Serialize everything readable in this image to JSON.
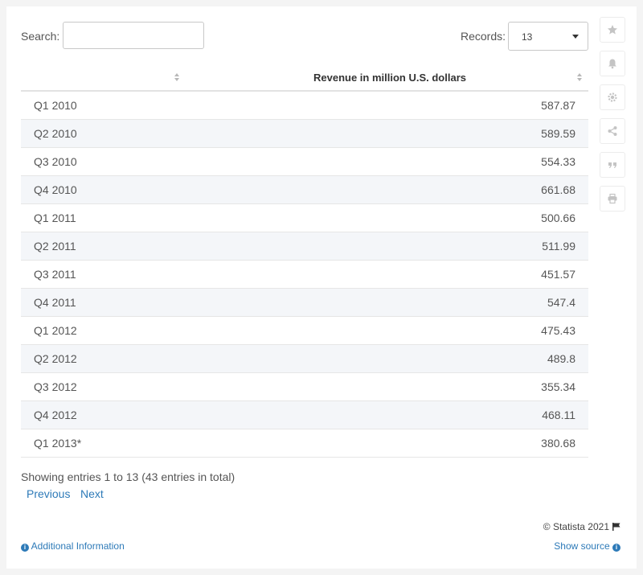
{
  "search": {
    "label": "Search:",
    "value": "",
    "placeholder": ""
  },
  "records": {
    "label": "Records:",
    "selected": "13"
  },
  "table": {
    "headers": [
      "",
      "Revenue in million U.S. dollars"
    ],
    "rows": [
      [
        "Q1 2010",
        "587.87"
      ],
      [
        "Q2 2010",
        "589.59"
      ],
      [
        "Q3 2010",
        "554.33"
      ],
      [
        "Q4 2010",
        "661.68"
      ],
      [
        "Q1 2011",
        "500.66"
      ],
      [
        "Q2 2011",
        "511.99"
      ],
      [
        "Q3 2011",
        "451.57"
      ],
      [
        "Q4 2011",
        "547.4"
      ],
      [
        "Q1 2012",
        "475.43"
      ],
      [
        "Q2 2012",
        "489.8"
      ],
      [
        "Q3 2012",
        "355.34"
      ],
      [
        "Q4 2012",
        "468.11"
      ],
      [
        "Q1 2013*",
        "380.68"
      ]
    ]
  },
  "chart_data": {
    "type": "table",
    "columns": [
      "",
      "Revenue in million U.S. dollars"
    ],
    "categories": [
      "Q1 2010",
      "Q2 2010",
      "Q3 2010",
      "Q4 2010",
      "Q1 2011",
      "Q2 2011",
      "Q3 2011",
      "Q4 2011",
      "Q1 2012",
      "Q2 2012",
      "Q3 2012",
      "Q4 2012",
      "Q1 2013*"
    ],
    "values": [
      587.87,
      589.59,
      554.33,
      661.68,
      500.66,
      511.99,
      451.57,
      547.4,
      475.43,
      489.8,
      355.34,
      468.11,
      380.68
    ]
  },
  "footer": {
    "showing": "Showing entries 1 to 13 (43 entries in total)",
    "previous": "Previous",
    "next": "Next",
    "copyright": "© Statista 2021",
    "additional_info": "Additional Information",
    "show_source": "Show source"
  },
  "sidebar": {
    "icons": [
      "star-icon",
      "bell-icon",
      "gear-icon",
      "share-icon",
      "quote-icon",
      "print-icon"
    ]
  },
  "colors": {
    "link": "#2d7ab8",
    "stripe": "#f4f6f9",
    "icon": "#c4c4c4"
  }
}
